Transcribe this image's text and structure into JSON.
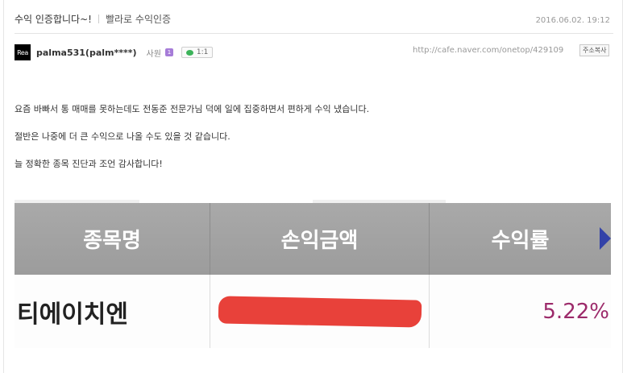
{
  "post": {
    "title": "수익 인증합니다~!",
    "category": "빨라로 수익인증",
    "date": "2016.06.02. 19:12"
  },
  "author": {
    "avatar_text": "Rea",
    "name": "palma531(palm****)",
    "role": "사원",
    "grade_badge": "1",
    "chat_label": "1:1"
  },
  "url": "http://cafe.naver.com/onetop/429109",
  "copy_button": "주소복사",
  "body": {
    "line1": "요즘 바빠서 통 매매를 못하는데도 전동준 전문가님 덕에 일에 집중하면서 편하게 수익 냈습니다.",
    "line2": "절반은 나중에 더 큰 수익으로 나올 수도 있을 것 같습니다.",
    "line3": "늘 정확한 종목 진단과 조언 감사합니다!"
  },
  "table": {
    "headers": [
      "종목명",
      "손익금액",
      "수익률"
    ],
    "row": {
      "name": "티에이치엔",
      "pnl": "",
      "return_rate": "5.22%"
    }
  },
  "colors": {
    "header_bg": "#a3a3a3",
    "return_rate": "#9c2a6a",
    "redaction": "#e8413a",
    "arrow": "#3342a8"
  }
}
